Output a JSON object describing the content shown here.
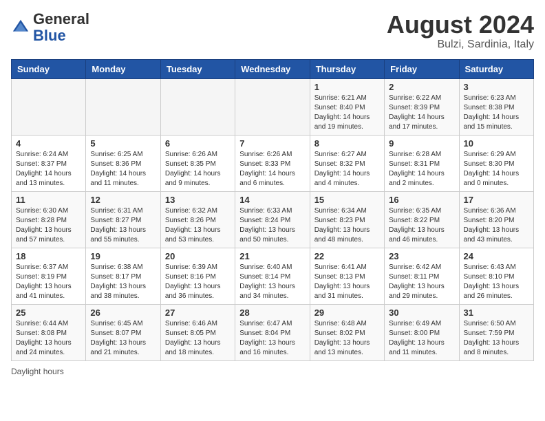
{
  "header": {
    "logo_general": "General",
    "logo_blue": "Blue",
    "month_year": "August 2024",
    "location": "Bulzi, Sardinia, Italy"
  },
  "days_of_week": [
    "Sunday",
    "Monday",
    "Tuesday",
    "Wednesday",
    "Thursday",
    "Friday",
    "Saturday"
  ],
  "weeks": [
    [
      {
        "day": "",
        "content": ""
      },
      {
        "day": "",
        "content": ""
      },
      {
        "day": "",
        "content": ""
      },
      {
        "day": "",
        "content": ""
      },
      {
        "day": "1",
        "content": "Sunrise: 6:21 AM\nSunset: 8:40 PM\nDaylight: 14 hours and 19 minutes."
      },
      {
        "day": "2",
        "content": "Sunrise: 6:22 AM\nSunset: 8:39 PM\nDaylight: 14 hours and 17 minutes."
      },
      {
        "day": "3",
        "content": "Sunrise: 6:23 AM\nSunset: 8:38 PM\nDaylight: 14 hours and 15 minutes."
      }
    ],
    [
      {
        "day": "4",
        "content": "Sunrise: 6:24 AM\nSunset: 8:37 PM\nDaylight: 14 hours and 13 minutes."
      },
      {
        "day": "5",
        "content": "Sunrise: 6:25 AM\nSunset: 8:36 PM\nDaylight: 14 hours and 11 minutes."
      },
      {
        "day": "6",
        "content": "Sunrise: 6:26 AM\nSunset: 8:35 PM\nDaylight: 14 hours and 9 minutes."
      },
      {
        "day": "7",
        "content": "Sunrise: 6:26 AM\nSunset: 8:33 PM\nDaylight: 14 hours and 6 minutes."
      },
      {
        "day": "8",
        "content": "Sunrise: 6:27 AM\nSunset: 8:32 PM\nDaylight: 14 hours and 4 minutes."
      },
      {
        "day": "9",
        "content": "Sunrise: 6:28 AM\nSunset: 8:31 PM\nDaylight: 14 hours and 2 minutes."
      },
      {
        "day": "10",
        "content": "Sunrise: 6:29 AM\nSunset: 8:30 PM\nDaylight: 14 hours and 0 minutes."
      }
    ],
    [
      {
        "day": "11",
        "content": "Sunrise: 6:30 AM\nSunset: 8:28 PM\nDaylight: 13 hours and 57 minutes."
      },
      {
        "day": "12",
        "content": "Sunrise: 6:31 AM\nSunset: 8:27 PM\nDaylight: 13 hours and 55 minutes."
      },
      {
        "day": "13",
        "content": "Sunrise: 6:32 AM\nSunset: 8:26 PM\nDaylight: 13 hours and 53 minutes."
      },
      {
        "day": "14",
        "content": "Sunrise: 6:33 AM\nSunset: 8:24 PM\nDaylight: 13 hours and 50 minutes."
      },
      {
        "day": "15",
        "content": "Sunrise: 6:34 AM\nSunset: 8:23 PM\nDaylight: 13 hours and 48 minutes."
      },
      {
        "day": "16",
        "content": "Sunrise: 6:35 AM\nSunset: 8:22 PM\nDaylight: 13 hours and 46 minutes."
      },
      {
        "day": "17",
        "content": "Sunrise: 6:36 AM\nSunset: 8:20 PM\nDaylight: 13 hours and 43 minutes."
      }
    ],
    [
      {
        "day": "18",
        "content": "Sunrise: 6:37 AM\nSunset: 8:19 PM\nDaylight: 13 hours and 41 minutes."
      },
      {
        "day": "19",
        "content": "Sunrise: 6:38 AM\nSunset: 8:17 PM\nDaylight: 13 hours and 38 minutes."
      },
      {
        "day": "20",
        "content": "Sunrise: 6:39 AM\nSunset: 8:16 PM\nDaylight: 13 hours and 36 minutes."
      },
      {
        "day": "21",
        "content": "Sunrise: 6:40 AM\nSunset: 8:14 PM\nDaylight: 13 hours and 34 minutes."
      },
      {
        "day": "22",
        "content": "Sunrise: 6:41 AM\nSunset: 8:13 PM\nDaylight: 13 hours and 31 minutes."
      },
      {
        "day": "23",
        "content": "Sunrise: 6:42 AM\nSunset: 8:11 PM\nDaylight: 13 hours and 29 minutes."
      },
      {
        "day": "24",
        "content": "Sunrise: 6:43 AM\nSunset: 8:10 PM\nDaylight: 13 hours and 26 minutes."
      }
    ],
    [
      {
        "day": "25",
        "content": "Sunrise: 6:44 AM\nSunset: 8:08 PM\nDaylight: 13 hours and 24 minutes."
      },
      {
        "day": "26",
        "content": "Sunrise: 6:45 AM\nSunset: 8:07 PM\nDaylight: 13 hours and 21 minutes."
      },
      {
        "day": "27",
        "content": "Sunrise: 6:46 AM\nSunset: 8:05 PM\nDaylight: 13 hours and 18 minutes."
      },
      {
        "day": "28",
        "content": "Sunrise: 6:47 AM\nSunset: 8:04 PM\nDaylight: 13 hours and 16 minutes."
      },
      {
        "day": "29",
        "content": "Sunrise: 6:48 AM\nSunset: 8:02 PM\nDaylight: 13 hours and 13 minutes."
      },
      {
        "day": "30",
        "content": "Sunrise: 6:49 AM\nSunset: 8:00 PM\nDaylight: 13 hours and 11 minutes."
      },
      {
        "day": "31",
        "content": "Sunrise: 6:50 AM\nSunset: 7:59 PM\nDaylight: 13 hours and 8 minutes."
      }
    ]
  ],
  "footer": {
    "daylight_label": "Daylight hours"
  }
}
